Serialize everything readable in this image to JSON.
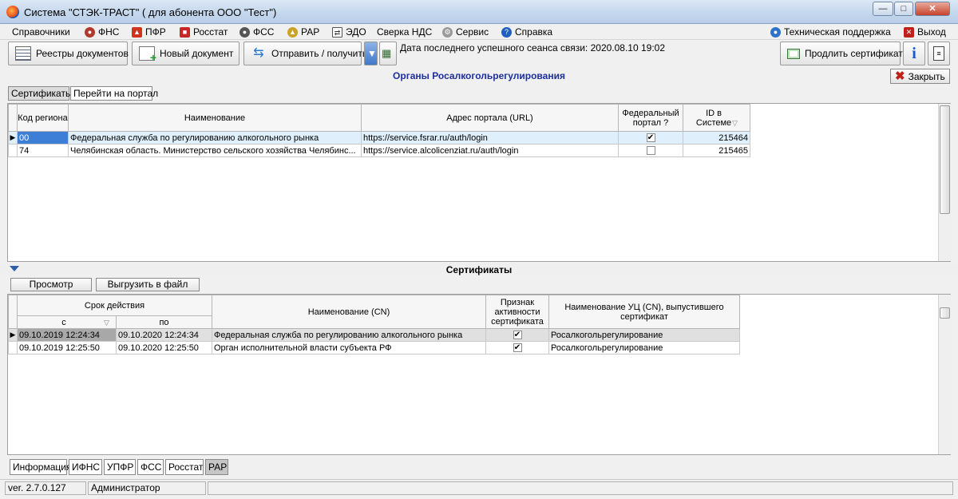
{
  "window": {
    "title": "Система \"СТЭК-ТРАСТ\" ( для абонента ООО \"Тест\")"
  },
  "menu": [
    {
      "label": "Справочники",
      "icon": ""
    },
    {
      "label": "ФНС",
      "icon": "fns-icon"
    },
    {
      "label": "ПФР",
      "icon": "pfr-icon"
    },
    {
      "label": "Росстат",
      "icon": "rosstat-icon"
    },
    {
      "label": "ФСС",
      "icon": "fss-icon"
    },
    {
      "label": "РАР",
      "icon": "rar-icon"
    },
    {
      "label": "ЭДО",
      "icon": "edo-icon"
    },
    {
      "label": "Сверка НДС",
      "icon": ""
    },
    {
      "label": "Сервис",
      "icon": "gear-icon"
    },
    {
      "label": "Справка",
      "icon": "help-icon"
    }
  ],
  "menu_right": {
    "support": "Техническая поддержка",
    "exit": "Выход"
  },
  "toolbar": {
    "registries": "Реестры документов",
    "new_doc": "Новый документ",
    "send_receive": "Отправить / получить",
    "last_session": "Дата последнего успешного сеанса связи: 2020.08.10 19:02",
    "renew_cert": "Продлить сертификат"
  },
  "section": {
    "title": "Органы Росалкогольрегулирования",
    "close": "Закрыть"
  },
  "tabs": [
    "Сертификаты",
    "Перейти на портал"
  ],
  "organs_table": {
    "headers": [
      "Код региона",
      "Наименование",
      "Адрес портала (URL)",
      "Федеральный портал ?",
      "ID в Системе"
    ],
    "rows": [
      {
        "code": "00",
        "name": "Федеральная служба по регулированию алкогольного рынка",
        "url": "https://service.fsrar.ru/auth/login",
        "federal": true,
        "id": "215464"
      },
      {
        "code": "74",
        "name": "Челябинская область. Министерство сельского хозяйства Челябинс...",
        "url": "https://service.alcolicenziat.ru/auth/login",
        "federal": false,
        "id": "215465"
      }
    ]
  },
  "certificates": {
    "title": "Сертификаты",
    "view_btn": "Просмотр",
    "export_btn": "Выгрузить в файл",
    "headers": {
      "validity": "Срок действия",
      "from": "с",
      "to": "по",
      "cn": "Наименование (CN)",
      "active": "Признак активности сертификата",
      "issuer": "Наименование УЦ (CN), выпустившего сертификат"
    },
    "rows": [
      {
        "from": "09.10.2019 12:24:34",
        "to": "09.10.2020 12:24:34",
        "cn": "Федеральная служба по регулированию алкогольного рынка",
        "active": true,
        "issuer": "Росалкогольрегулирование"
      },
      {
        "from": "09.10.2019 12:25:50",
        "to": "09.10.2020 12:25:50",
        "cn": "Орган исполнительной власти субъекта РФ",
        "active": true,
        "issuer": "Росалкогольрегулирование"
      }
    ]
  },
  "bottom_tabs": [
    "Информация",
    "ИФНС",
    "УПФР",
    "ФСС",
    "Росстат",
    "РАР"
  ],
  "status": {
    "version": "ver. 2.7.0.127",
    "user": "Администратор"
  }
}
